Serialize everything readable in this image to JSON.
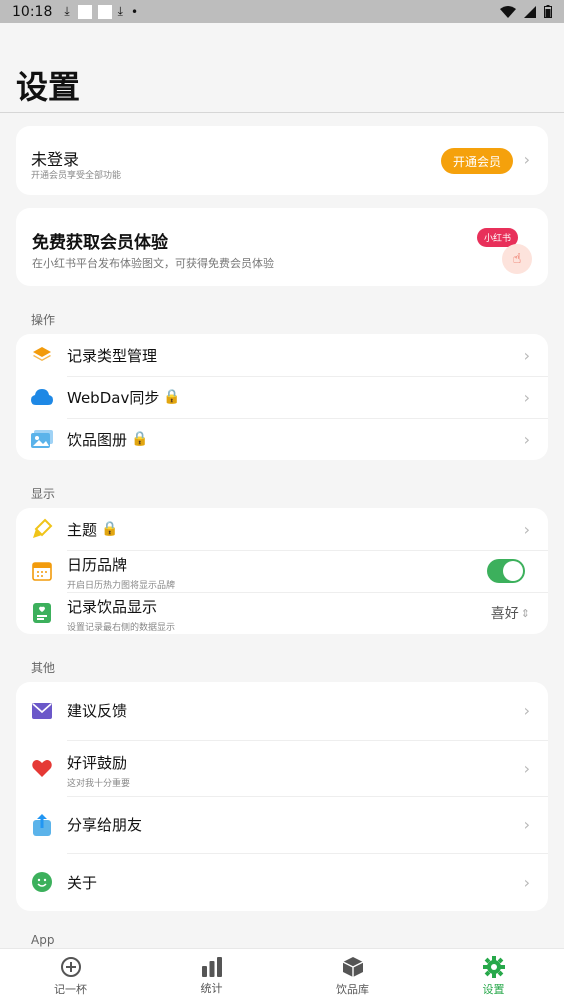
{
  "status_bar": {
    "time": "10:18"
  },
  "page": {
    "title": "设置"
  },
  "account": {
    "title": "未登录",
    "subtitle": "开通会员享受全部功能",
    "vip_button": "开通会员"
  },
  "promo": {
    "title": "免费获取会员体验",
    "subtitle": "在小红书平台发布体验图文，可获得免费会员体验",
    "badge": "小红书"
  },
  "sections": {
    "operations": {
      "label": "操作",
      "items": [
        {
          "label": "记录类型管理",
          "icon": "layers-icon"
        },
        {
          "label": "WebDav同步",
          "icon": "cloud-icon",
          "locked": true
        },
        {
          "label": "饮品图册",
          "icon": "image-icon",
          "locked": true
        }
      ]
    },
    "display": {
      "label": "显示",
      "items": [
        {
          "label": "主题",
          "icon": "brush-icon",
          "locked": true
        },
        {
          "label": "日历品牌",
          "sub": "开启日历热力图将显示品牌",
          "icon": "calendar-icon",
          "toggle": true
        },
        {
          "label": "记录饮品显示",
          "sub": "设置记录最右侧的数据显示",
          "icon": "card-icon",
          "value": "喜好"
        }
      ]
    },
    "other": {
      "label": "其他",
      "items": [
        {
          "label": "建议反馈",
          "icon": "mail-icon"
        },
        {
          "label": "好评鼓励",
          "sub": "这对我十分重要",
          "icon": "heart-icon"
        },
        {
          "label": "分享给朋友",
          "icon": "share-icon"
        },
        {
          "label": "关于",
          "icon": "smile-icon"
        }
      ]
    },
    "app": {
      "label": "App"
    }
  },
  "nav": [
    {
      "label": "记一杯",
      "icon": "cup-add-icon"
    },
    {
      "label": "统计",
      "icon": "bar-chart-icon"
    },
    {
      "label": "饮品库",
      "icon": "box-icon"
    },
    {
      "label": "设置",
      "icon": "gear-icon",
      "active": true
    }
  ],
  "colors": {
    "accent": "#27a84a",
    "vip": "#f5a10c",
    "badge": "#e8305a"
  }
}
